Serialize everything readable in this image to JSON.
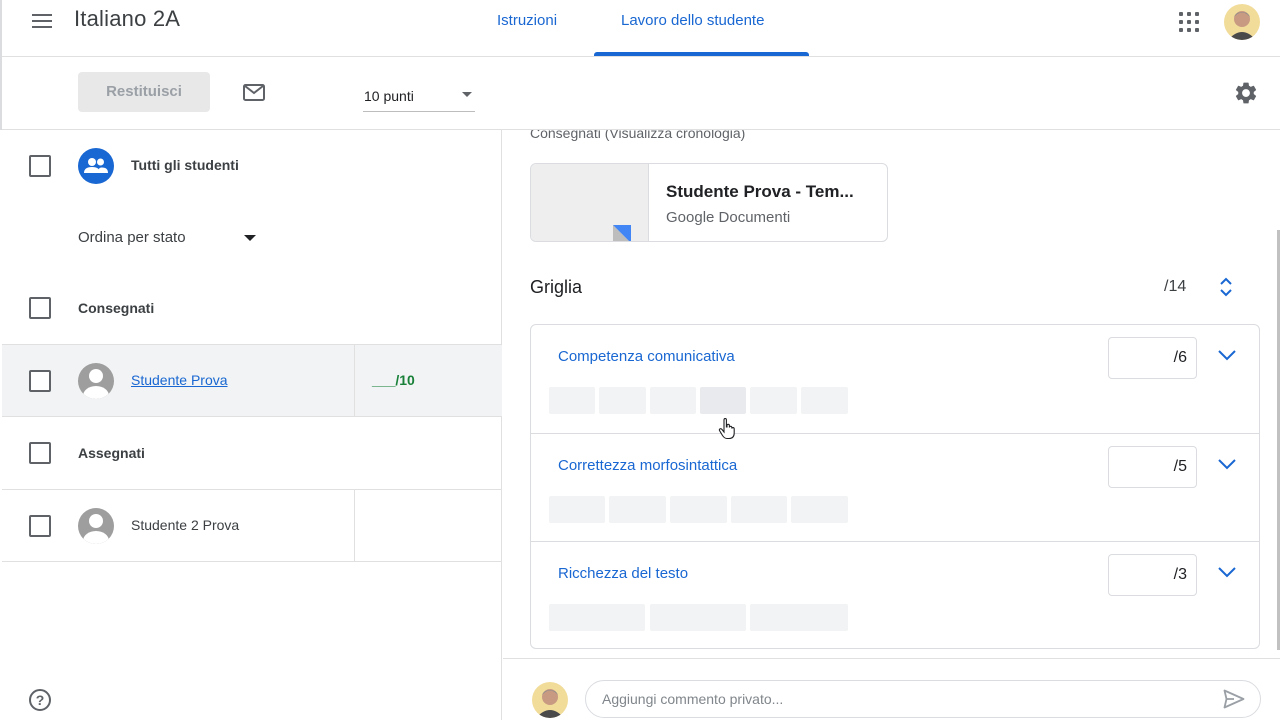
{
  "header": {
    "menu_icon": "hamburger-menu-icon",
    "class_title": "Italiano 2A",
    "tabs": [
      {
        "label": "Istruzioni",
        "active": false
      },
      {
        "label": "Lavoro dello studente",
        "active": true
      }
    ],
    "apps_icon": "apps-grid-icon",
    "accent_color": "#1967d2"
  },
  "toolbar": {
    "return_label": "Restituisci",
    "mail_icon": "mail-icon",
    "points_value": "10 punti",
    "settings_icon": "gear-icon"
  },
  "left_panel": {
    "all_students_label": "Tutti gli studenti",
    "sort_label": "Ordina per stato",
    "sections": [
      {
        "label": "Consegnati",
        "students": [
          {
            "name": "Studente Prova",
            "grade": "___/10",
            "selected": true
          }
        ]
      },
      {
        "label": "Assegnati",
        "students": [
          {
            "name": "Studente 2 Prova",
            "grade": "",
            "selected": false
          }
        ]
      }
    ],
    "help_icon": "?"
  },
  "right_panel": {
    "submitted_history": "Consegnati (Visualizza cronologia)",
    "attachment": {
      "title": "Studente Prova - Tem...",
      "type": "Google Documenti"
    },
    "rubric": {
      "title": "Griglia",
      "total": "/14",
      "criteria": [
        {
          "title": "Competenza comunicativa",
          "score": "/6",
          "levels": 6
        },
        {
          "title": "Correttezza morfosintattica",
          "score": "/5",
          "levels": 5
        },
        {
          "title": "Ricchezza del testo",
          "score": "/3",
          "levels": 3
        }
      ]
    }
  },
  "comment": {
    "placeholder": "Aggiungi commento privato..."
  }
}
